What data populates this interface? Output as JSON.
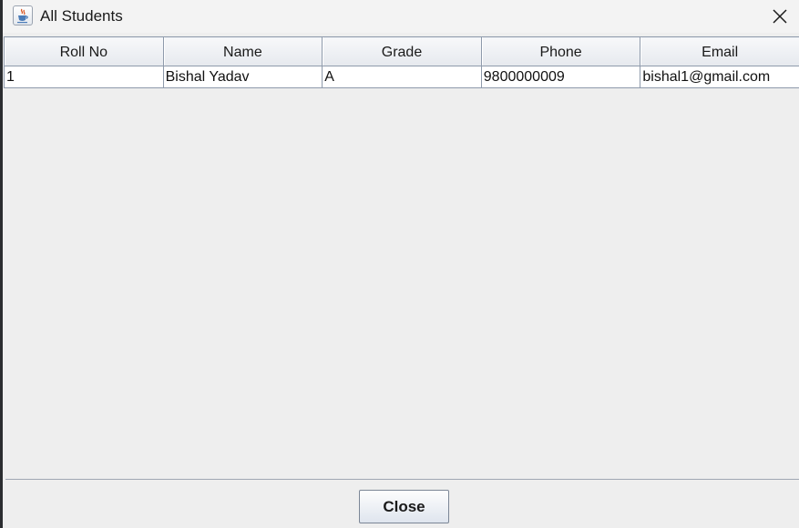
{
  "window": {
    "title": "All Students",
    "icon": "java-cup-icon"
  },
  "table": {
    "columns": [
      "Roll No",
      "Name",
      "Grade",
      "Phone",
      "Email"
    ],
    "rows": [
      [
        "1",
        "Bishal Yadav",
        "A",
        "9800000009",
        "bishal1@gmail.com"
      ]
    ]
  },
  "footer": {
    "close_label": "Close"
  }
}
